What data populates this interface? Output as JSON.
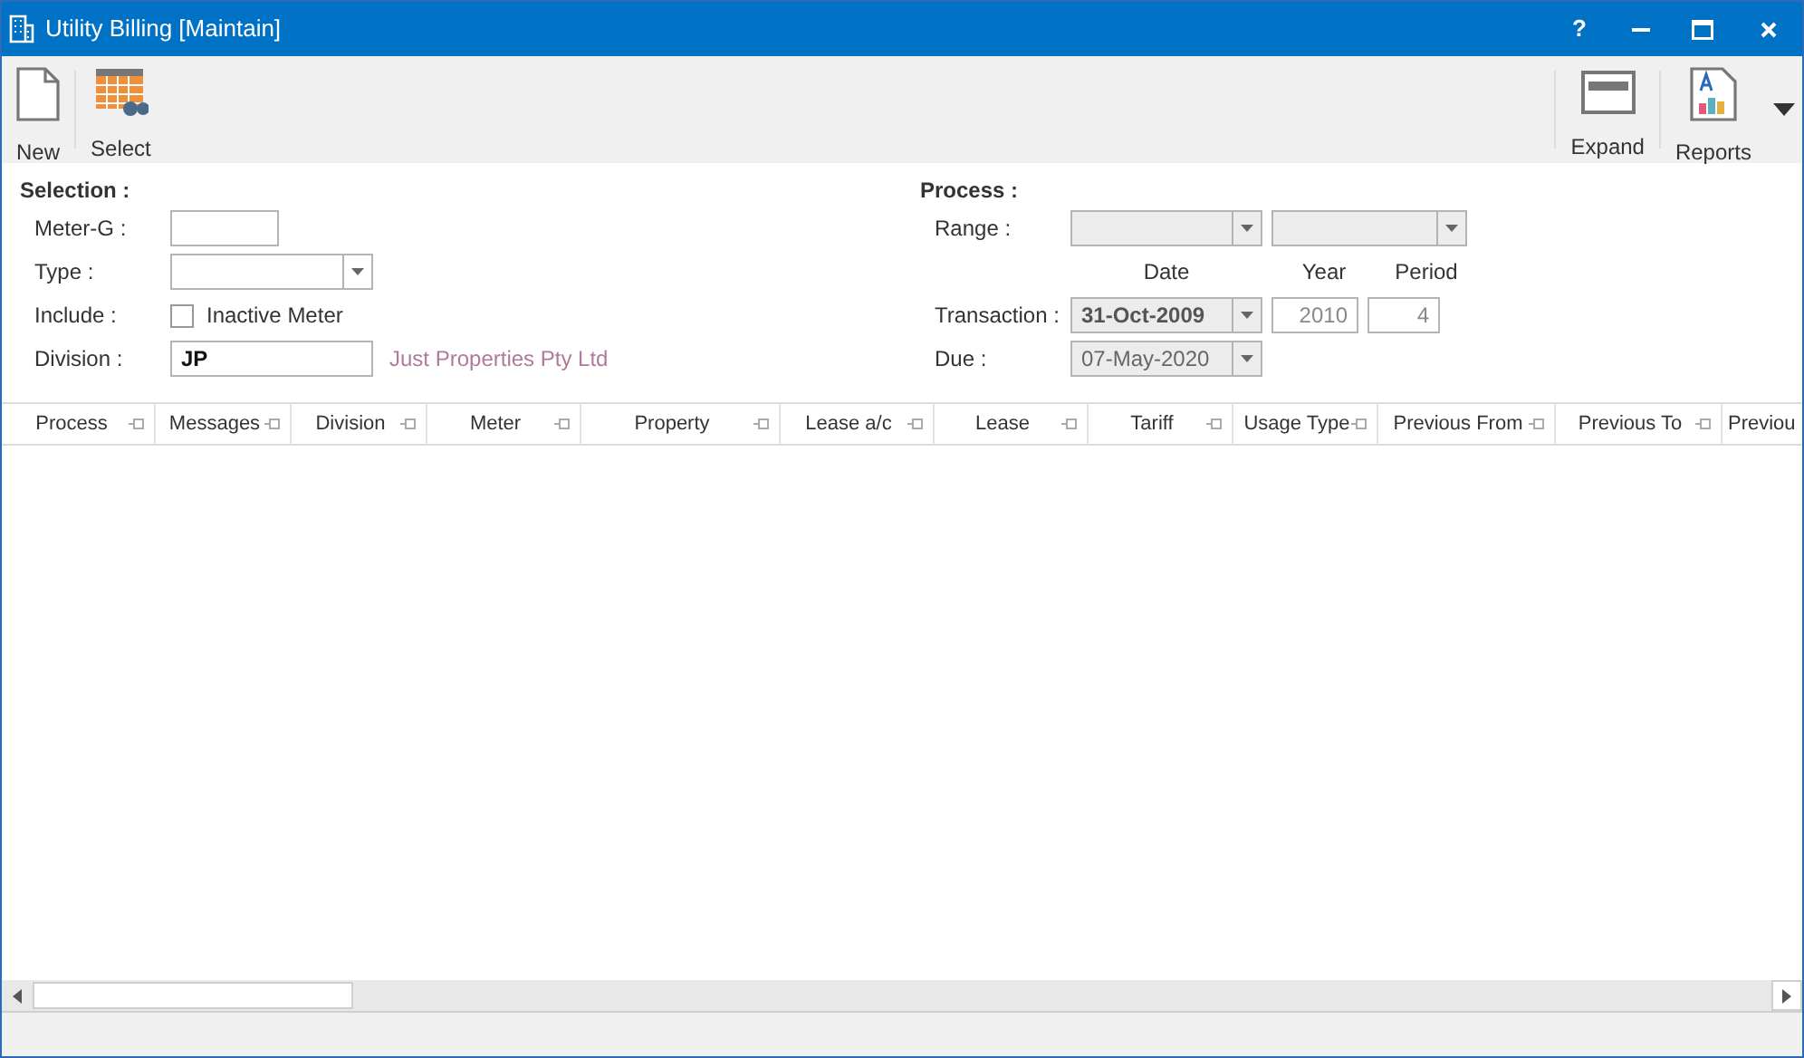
{
  "window": {
    "title": "Utility Billing [Maintain]",
    "help": "?"
  },
  "toolbar_left": [
    {
      "label": "New",
      "kind": "page"
    },
    {
      "label": "Select",
      "kind": "grid"
    }
  ],
  "toolbar_right": [
    {
      "label": "Expand",
      "kind": "window"
    },
    {
      "label": "Reports",
      "kind": "report"
    }
  ],
  "selection": {
    "heading": "Selection :",
    "meter_g": {
      "label": "Meter-G :"
    },
    "type": {
      "label": "Type :"
    },
    "include": {
      "label": "Include :",
      "checkbox": "Inactive Meter",
      "checked": false
    },
    "division": {
      "label": "Division :",
      "value": "JP",
      "description": "Just Properties Pty Ltd"
    }
  },
  "process": {
    "heading": "Process :",
    "range_label": "Range :",
    "range": [
      {
        "disabled": true
      },
      {
        "disabled": true
      }
    ],
    "column_headers": [
      "Date",
      "Year",
      "Period"
    ],
    "transaction": {
      "label": "Transaction :",
      "date": "31-Oct-2009",
      "year": "2010",
      "period": "4",
      "disabled": true
    },
    "due": {
      "label": "Due :",
      "date": "07-May-2020",
      "disabled": true
    }
  },
  "table": {
    "columns": [
      {
        "label": "Process",
        "pin": true
      },
      {
        "label": "Messages",
        "pin": true
      },
      {
        "label": "Division",
        "pin": true
      },
      {
        "label": "Meter",
        "pin": true
      },
      {
        "label": "Property",
        "pin": true
      },
      {
        "label": "Lease a/c",
        "pin": true
      },
      {
        "label": "Lease",
        "pin": true
      },
      {
        "label": "Tariff",
        "pin": true
      },
      {
        "label": "Usage Type",
        "pin": true
      },
      {
        "label": "Previous From",
        "pin": true
      },
      {
        "label": "Previous To",
        "pin": true
      },
      {
        "label": "Previou",
        "pin": false
      }
    ]
  }
}
